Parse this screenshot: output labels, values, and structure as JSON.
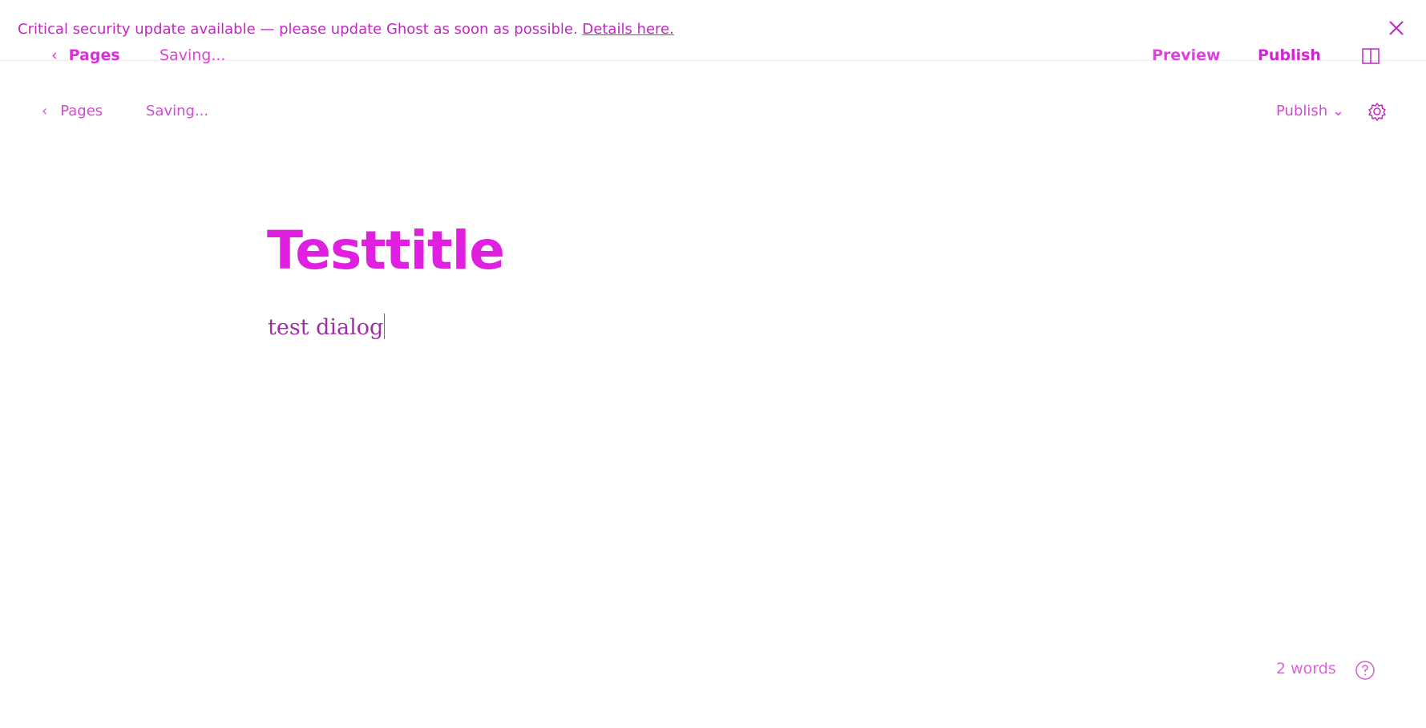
{
  "banner": {
    "message": "Critical security update available — please update Ghost as soon as possible.",
    "link_text": "Details here.",
    "close_icon": "close-icon"
  },
  "top_toolbar": {
    "back_chevron": "‹",
    "back_label": "Pages",
    "status": "Saving...",
    "preview_label": "Preview",
    "publish_label": "Publish",
    "sidebar_toggle_icon": "split-view-icon"
  },
  "editor_toolbar": {
    "back_chevron": "‹",
    "back_label": "Pages",
    "status": "Saving...",
    "publish_label": "Publish",
    "publish_chevron": "⌄",
    "settings_icon": "gear-icon"
  },
  "editor": {
    "title": "Testtitle",
    "body": "test dialog"
  },
  "footer": {
    "word_count": "2 words",
    "help_icon": "question-icon"
  },
  "colors": {
    "accent": "#e020e0",
    "text": "#c426c4",
    "divider": "#ececec"
  }
}
